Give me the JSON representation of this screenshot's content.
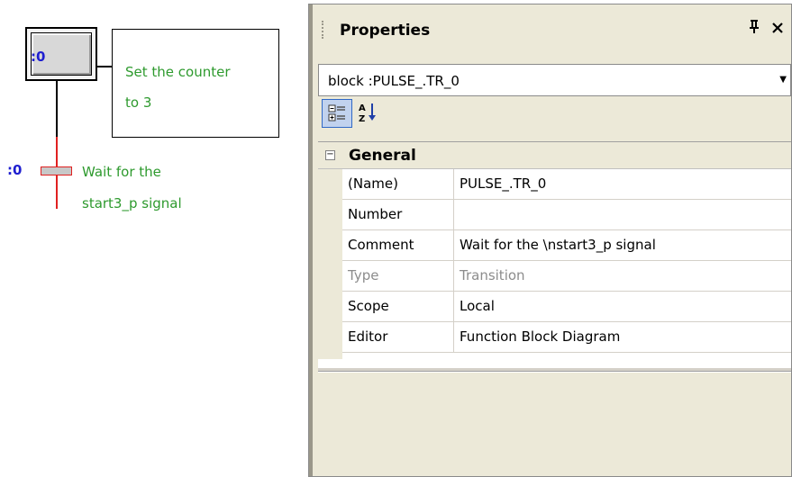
{
  "diagram": {
    "step": {
      "number": ":0"
    },
    "action": {
      "text": "Set the counter\nto 3"
    },
    "transition": {
      "number": ":0",
      "text": "Wait for the\nstart3_p signal"
    },
    "colors": {
      "number": "#1f1fd0",
      "comment": "#2e9a2e",
      "active_link": "#e02020"
    }
  },
  "panel": {
    "title": "Properties",
    "pin_icon": "pin-icon",
    "close_icon": "close-icon",
    "object_selector": {
      "value": "block :PULSE_.TR_0"
    },
    "toolbar": {
      "categorized_icon": "categorized-icon",
      "alphabetical_icon": "alphabetical-icon"
    },
    "category": {
      "label": "General",
      "toggle": "⊟"
    },
    "rows": [
      {
        "name": "(Name)",
        "value": "PULSE_.TR_0",
        "disabled": false
      },
      {
        "name": "Number",
        "value": "",
        "disabled": false
      },
      {
        "name": "Comment",
        "value": "Wait for the \\nstart3_p signal",
        "disabled": false
      },
      {
        "name": "Type",
        "value": "Transition",
        "disabled": true
      },
      {
        "name": "Scope",
        "value": "Local",
        "disabled": false
      },
      {
        "name": "Editor",
        "value": "Function Block Diagram",
        "disabled": false
      }
    ]
  }
}
